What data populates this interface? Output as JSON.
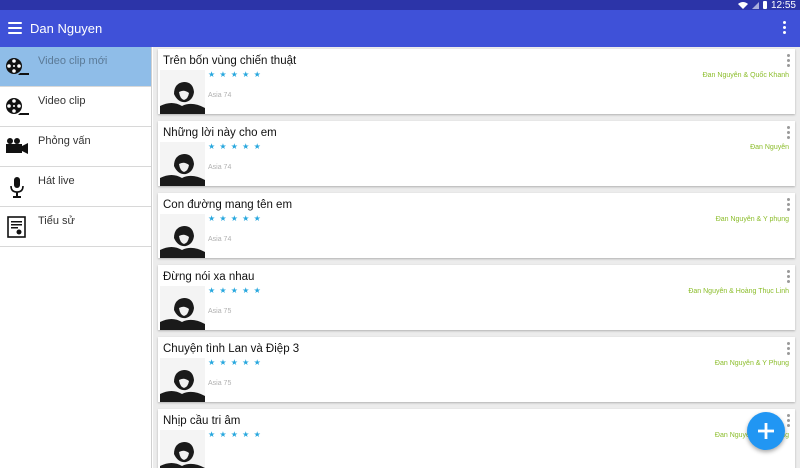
{
  "status": {
    "time": "12:55"
  },
  "app": {
    "title": "Dan Nguyen"
  },
  "nav": [
    {
      "label": "Video clip mới",
      "icon": "film-reel-icon",
      "active": true
    },
    {
      "label": "Video clip",
      "icon": "film-reel-icon",
      "active": false
    },
    {
      "label": "Phỏng vấn",
      "icon": "video-camera-icon",
      "active": false
    },
    {
      "label": "Hát live",
      "icon": "microphone-icon",
      "active": false
    },
    {
      "label": "Tiểu sử",
      "icon": "certificate-icon",
      "active": false
    }
  ],
  "songs": [
    {
      "title": "Trên bốn vùng chiến thuật",
      "artist": "Đan Nguyên & Quốc Khanh",
      "album": "Asia 74",
      "stars": "★ ★ ★ ★ ★"
    },
    {
      "title": "Những lời này cho em",
      "artist": "Đan Nguyên",
      "album": "Asia 74",
      "stars": "★ ★ ★ ★ ★"
    },
    {
      "title": "Con đường mang tên em",
      "artist": "Đan Nguyên & Y phụng",
      "album": "Asia 74",
      "stars": "★ ★ ★ ★ ★"
    },
    {
      "title": "Đừng nói xa nhau",
      "artist": "Đan Nguyên & Hoàng Thục Linh",
      "album": "Asia 75",
      "stars": "★ ★ ★ ★ ★"
    },
    {
      "title": "Chuyện tình Lan và Điệp 3",
      "artist": "Đan Nguyên & Y Phụng",
      "album": "Asia 75",
      "stars": "★ ★ ★ ★ ★"
    },
    {
      "title": "Nhịp cầu tri âm",
      "artist": "Đan Nguyên & Y Phụng",
      "album": "",
      "stars": "★ ★ ★ ★ ★"
    }
  ],
  "colors": {
    "primary": "#3f51d8",
    "status_bar": "#2c34a8",
    "accent": "#2196f3",
    "nav_active": "#8fbde8",
    "artist_text": "#8bbd2a",
    "star": "#27a7de"
  }
}
